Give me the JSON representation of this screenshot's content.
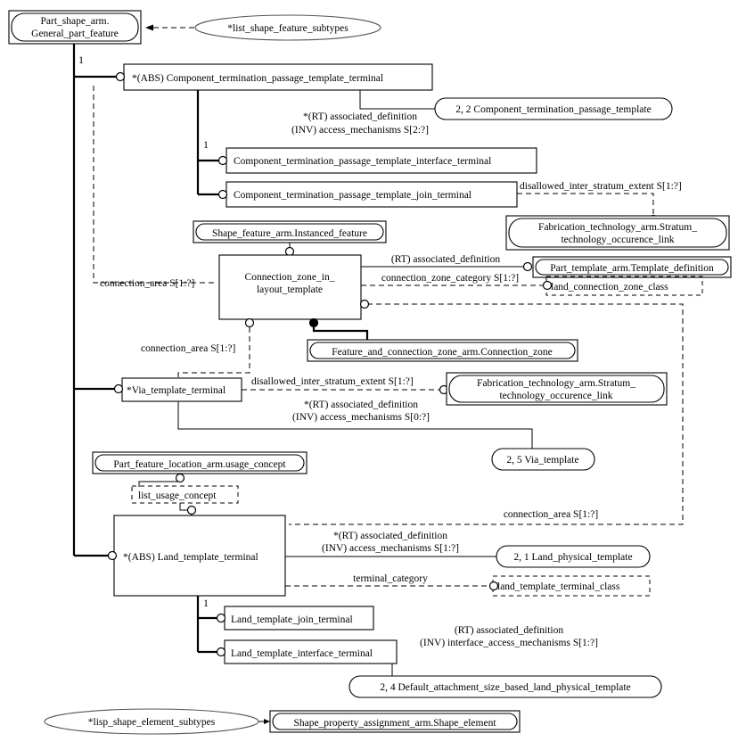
{
  "diagram": {
    "title": "EXPRESS-G ARM diagram",
    "entities": {
      "general_part_feature": "Part_shape_arm.\nGeneral_part_feature",
      "general_part_feature_l1": "Part_shape_arm.",
      "general_part_feature_l2": "General_part_feature",
      "ctpt_terminal": "*(ABS) Component_termination_passage_template_terminal",
      "ctpt_interface_terminal": "Component_termination_passage_template_interface_terminal",
      "ctpt_join_terminal": "Component_termination_passage_template_join_terminal",
      "instanced_feature": "Shape_feature_arm.Instanced_feature",
      "connection_zone_in_layout_template_l1": "Connection_zone_in_",
      "connection_zone_in_layout_template_l2": "layout_template",
      "stratum_link_1_l1": "Fabrication_technology_arm.Stratum_",
      "stratum_link_1_l2": "technology_occurence_link",
      "template_definition": "Part_template_arm.Template_definition",
      "connection_zone": "Feature_and_connection_zone_arm.Connection_zone",
      "via_template_terminal": "*Via_template_terminal",
      "stratum_link_2_l1": "Fabrication_technology_arm.Stratum_",
      "stratum_link_2_l2": "technology_occurence_link",
      "usage_concept": "Part_feature_location_arm.usage_concept",
      "land_template_terminal": "*(ABS) Land_template_terminal",
      "land_template_join_terminal": "Land_template_join_terminal",
      "land_template_interface_terminal": "Land_template_interface_terminal",
      "shape_element": "Shape_property_assignment_arm.Shape_element"
    },
    "page_refs": {
      "ctp_template": "2, 2 Component_termination_passage_template",
      "via_template": "2, 5 Via_template",
      "land_physical_template": "2, 1 Land_physical_template",
      "default_attachment": "2, 4 Default_attachment_size_based_land_physical_template"
    },
    "select_types": {
      "list_shape_feature_subtypes": "*list_shape_feature_subtypes",
      "lisp_shape_element_subtypes": "*lisp_shape_element_subtypes"
    },
    "enum_types": {
      "land_connection_zone_class": "land_connection_zone_class",
      "land_template_terminal_class": "land_template_terminal_class",
      "list_usage_concept": "list_usage_concept"
    },
    "attributes": {
      "ctpt_assoc_def_l1": "*(RT) associated_definition",
      "ctpt_assoc_def_l2": "(INV) access_mechanisms S[2:?]",
      "join_disallowed": "disallowed_inter_stratum_extent S[1:?]",
      "czlt_connection_area": "connection_area S[1:?]",
      "czlt_assoc_def": "(RT) associated_definition",
      "czlt_zone_category": "connection_zone_category S[1:?]",
      "via_connection_area": "connection_area S[1:?]",
      "via_disallowed": "disallowed_inter_stratum_extent S[1:?]",
      "via_assoc_def_l1": "*(RT) associated_definition",
      "via_assoc_def_l2": "(INV) access_mechanisms S[0:?]",
      "ltt_connection_area": "connection_area S[1:?]",
      "ltt_assoc_def_l1": "*(RT) associated_definition",
      "ltt_assoc_def_l2": "(INV) access_mechanisms S[1:?]",
      "ltt_terminal_category": "terminal_category",
      "lti_assoc_def_l1": "(RT) associated_definition",
      "lti_assoc_def_l2": "(INV) interface_access_mechanisms S[1:?]"
    },
    "cardinalities": {
      "c1": "1",
      "c2": "1",
      "c3": "1"
    },
    "colors": {
      "stroke": "#000000",
      "background": "#ffffff",
      "ellipse_stroke": "#555555"
    }
  }
}
